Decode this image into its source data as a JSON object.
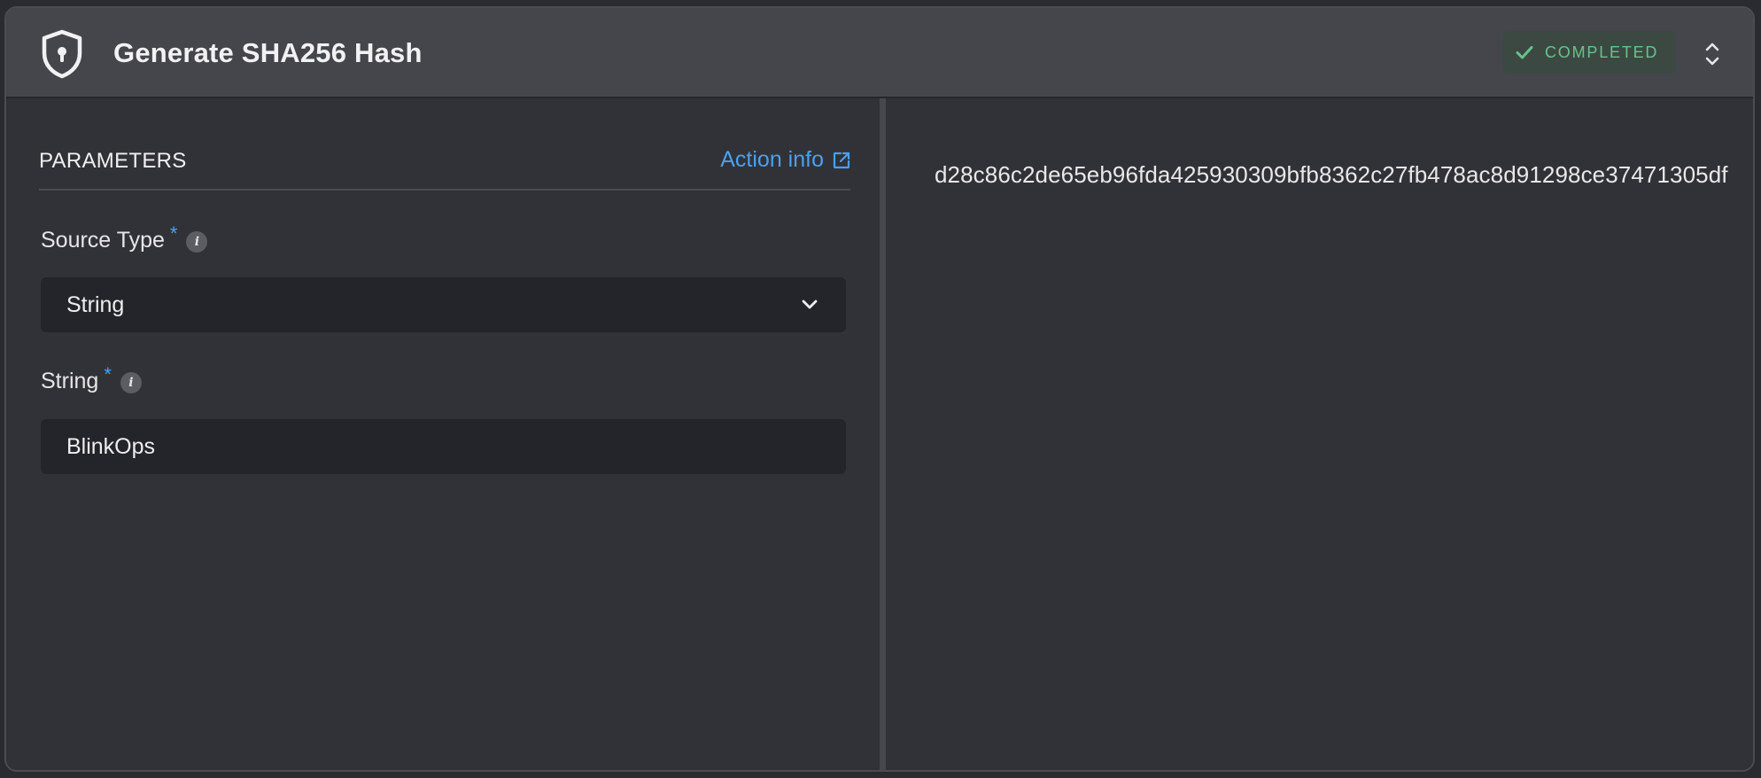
{
  "header": {
    "title": "Generate SHA256 Hash",
    "status": "COMPLETED",
    "icon": "shield-lock-icon",
    "status_color": "#67c38a"
  },
  "parameters": {
    "title": "PARAMETERS",
    "action_info_label": "Action info",
    "fields": [
      {
        "label": "Source Type",
        "required": "*",
        "value": "String",
        "kind": "select"
      },
      {
        "label": "String",
        "required": "*",
        "value": "BlinkOps",
        "kind": "text"
      }
    ]
  },
  "output": {
    "hash": "d28c86c2de65eb96fda425930309bfb8362c27fb478ac8d91298ce37471305df"
  },
  "colors": {
    "accent": "#4ba0ef",
    "success": "#67c38a",
    "header_bg": "#45464c",
    "panel_bg": "#313237",
    "input_bg": "#24252a"
  }
}
